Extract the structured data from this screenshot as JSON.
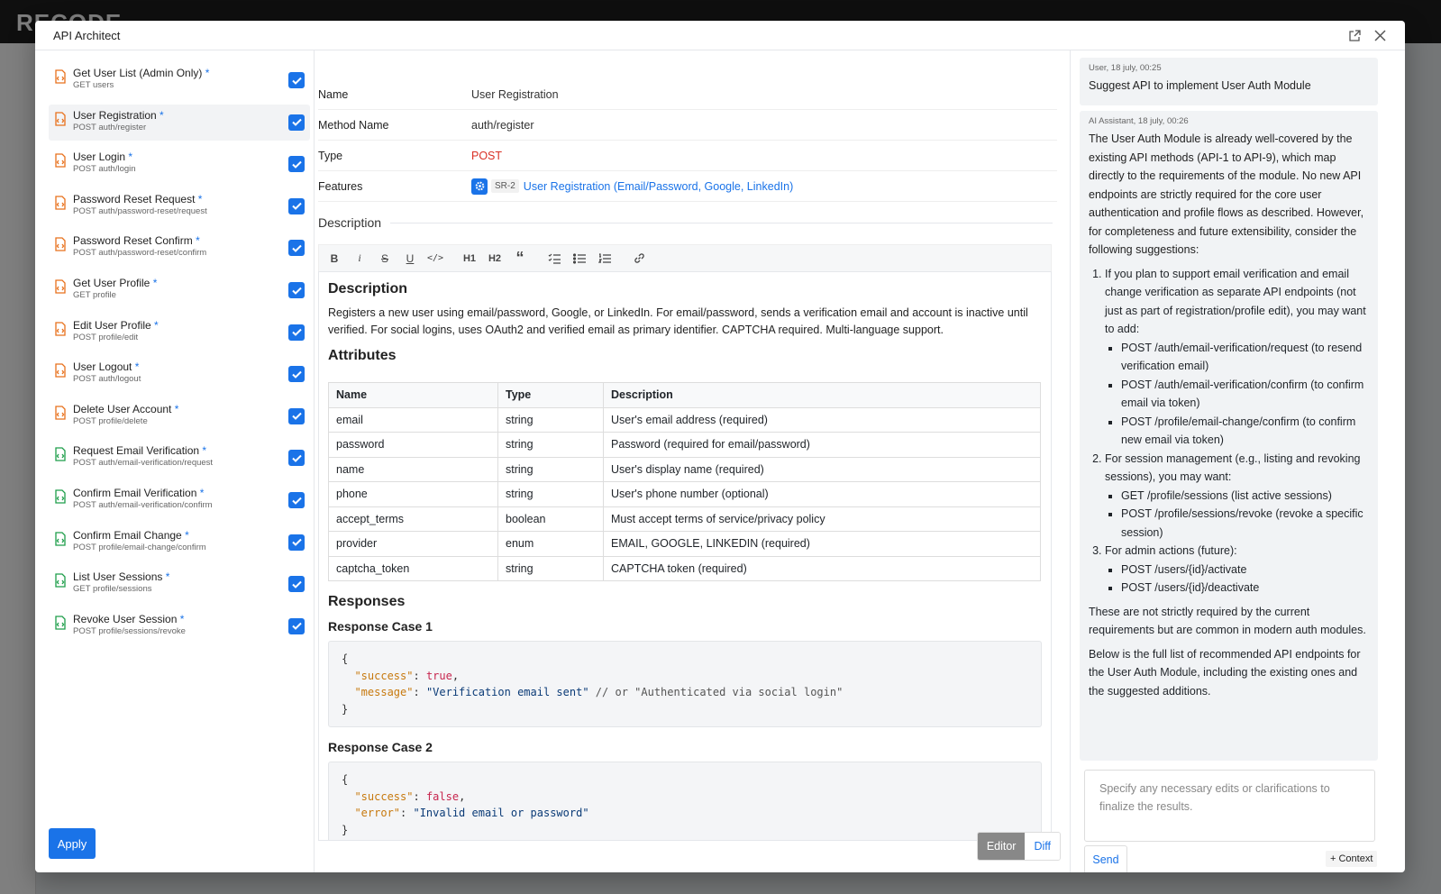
{
  "modal": {
    "title": "API Architect",
    "apply_label": "Apply"
  },
  "api_list": [
    {
      "title": "Get User List (Admin Only)",
      "sub": "GET users",
      "color": "#e8711c"
    },
    {
      "title": "User Registration",
      "sub": "POST auth/register",
      "color": "#e8711c",
      "selected": true
    },
    {
      "title": "User Login",
      "sub": "POST auth/login",
      "color": "#e8711c"
    },
    {
      "title": "Password Reset Request",
      "sub": "POST auth/password-reset/request",
      "color": "#e8711c"
    },
    {
      "title": "Password Reset Confirm",
      "sub": "POST auth/password-reset/confirm",
      "color": "#e8711c"
    },
    {
      "title": "Get User Profile",
      "sub": "GET profile",
      "color": "#e8711c"
    },
    {
      "title": "Edit User Profile",
      "sub": "POST profile/edit",
      "color": "#e8711c"
    },
    {
      "title": "User Logout",
      "sub": "POST auth/logout",
      "color": "#e8711c"
    },
    {
      "title": "Delete User Account",
      "sub": "POST profile/delete",
      "color": "#e8711c"
    },
    {
      "title": "Request Email Verification",
      "sub": "POST auth/email-verification/request",
      "color": "#1e9e4a"
    },
    {
      "title": "Confirm Email Verification",
      "sub": "POST auth/email-verification/confirm",
      "color": "#1e9e4a"
    },
    {
      "title": "Confirm Email Change",
      "sub": "POST profile/email-change/confirm",
      "color": "#1e9e4a"
    },
    {
      "title": "List User Sessions",
      "sub": "GET profile/sessions",
      "color": "#1e9e4a"
    },
    {
      "title": "Revoke User Session",
      "sub": "POST profile/sessions/revoke",
      "color": "#1e9e4a"
    }
  ],
  "required_mark": "*",
  "fields": {
    "name_label": "Name",
    "name_value": "User Registration",
    "method_label": "Method Name",
    "method_value": "auth/register",
    "type_label": "Type",
    "type_value": "POST",
    "features_label": "Features",
    "feature_tag": "SR-2",
    "feature_link": "User Registration (Email/Password, Google, LinkedIn)",
    "description_label": "Description"
  },
  "toolbar": [
    "B",
    "i",
    "S",
    "U",
    "</>",
    "H1",
    "H2",
    "“",
    "checklist",
    "bullets",
    "numbered",
    "link"
  ],
  "doc": {
    "h_description": "Description",
    "description": "Registers a new user using email/password, Google, or LinkedIn. For email/password, sends a verification email and account is inactive until verified. For social logins, uses OAuth2 and verified email as primary identifier. CAPTCHA required. Multi-language support.",
    "h_attributes": "Attributes",
    "attr_headers": [
      "Name",
      "Type",
      "Description"
    ],
    "attributes": [
      [
        "email",
        "string",
        "User's email address (required)"
      ],
      [
        "password",
        "string",
        "Password (required for email/password)"
      ],
      [
        "name",
        "string",
        "User's display name (required)"
      ],
      [
        "phone",
        "string",
        "User's phone number (optional)"
      ],
      [
        "accept_terms",
        "boolean",
        "Must accept terms of service/privacy policy"
      ],
      [
        "provider",
        "enum",
        "EMAIL, GOOGLE, LINKEDIN (required)"
      ],
      [
        "captcha_token",
        "string",
        "CAPTCHA token (required)"
      ]
    ],
    "h_responses": "Responses",
    "case1": "Response Case 1",
    "case1_code": {
      "success": "true",
      "message": "\"Verification email sent\"",
      "comment": "// or \"Authenticated via social login\""
    },
    "case2": "Response Case 2",
    "case2_code": {
      "success": "false",
      "error": "\"Invalid email or password\""
    }
  },
  "view_toggle": {
    "editor": "Editor",
    "diff": "Diff"
  },
  "chat": {
    "user_meta": "User, 18 july, 00:25",
    "user_msg": "Suggest API to implement User Auth Module",
    "ai_meta": "AI Assistant, 18 july, 00:26",
    "ai_intro": "The User Auth Module is already well-covered by the existing API methods (API-1 to API-9), which map directly to the requirements of the module. No new API endpoints are strictly required for the core user authentication and profile flows as described. However, for completeness and future extensibility, consider the following suggestions:",
    "points": [
      {
        "text": "If you plan to support email verification and email change verification as separate API endpoints (not just as part of registration/profile edit), you may want to add:",
        "subs": [
          "POST /auth/email-verification/request (to resend verification email)",
          "POST /auth/email-verification/confirm (to confirm email via token)",
          "POST /profile/email-change/confirm (to confirm new email via token)"
        ]
      },
      {
        "text": "For session management (e.g., listing and revoking sessions), you may want:",
        "subs": [
          "GET /profile/sessions (list active sessions)",
          "POST /profile/sessions/revoke (revoke a specific session)"
        ]
      },
      {
        "text": "For admin actions (future):",
        "subs": [
          "POST /users/{id}/activate",
          "POST /users/{id}/deactivate"
        ]
      }
    ],
    "ai_p2": "These are not strictly required by the current requirements but are common in modern auth modules.",
    "ai_p3": "Below is the full list of recommended API endpoints for the User Auth Module, including the existing ones and the suggested additions.",
    "placeholder": "Specify any necessary edits or clarifications to finalize the results.",
    "send_label": "Send",
    "context_label": "+ Context"
  }
}
